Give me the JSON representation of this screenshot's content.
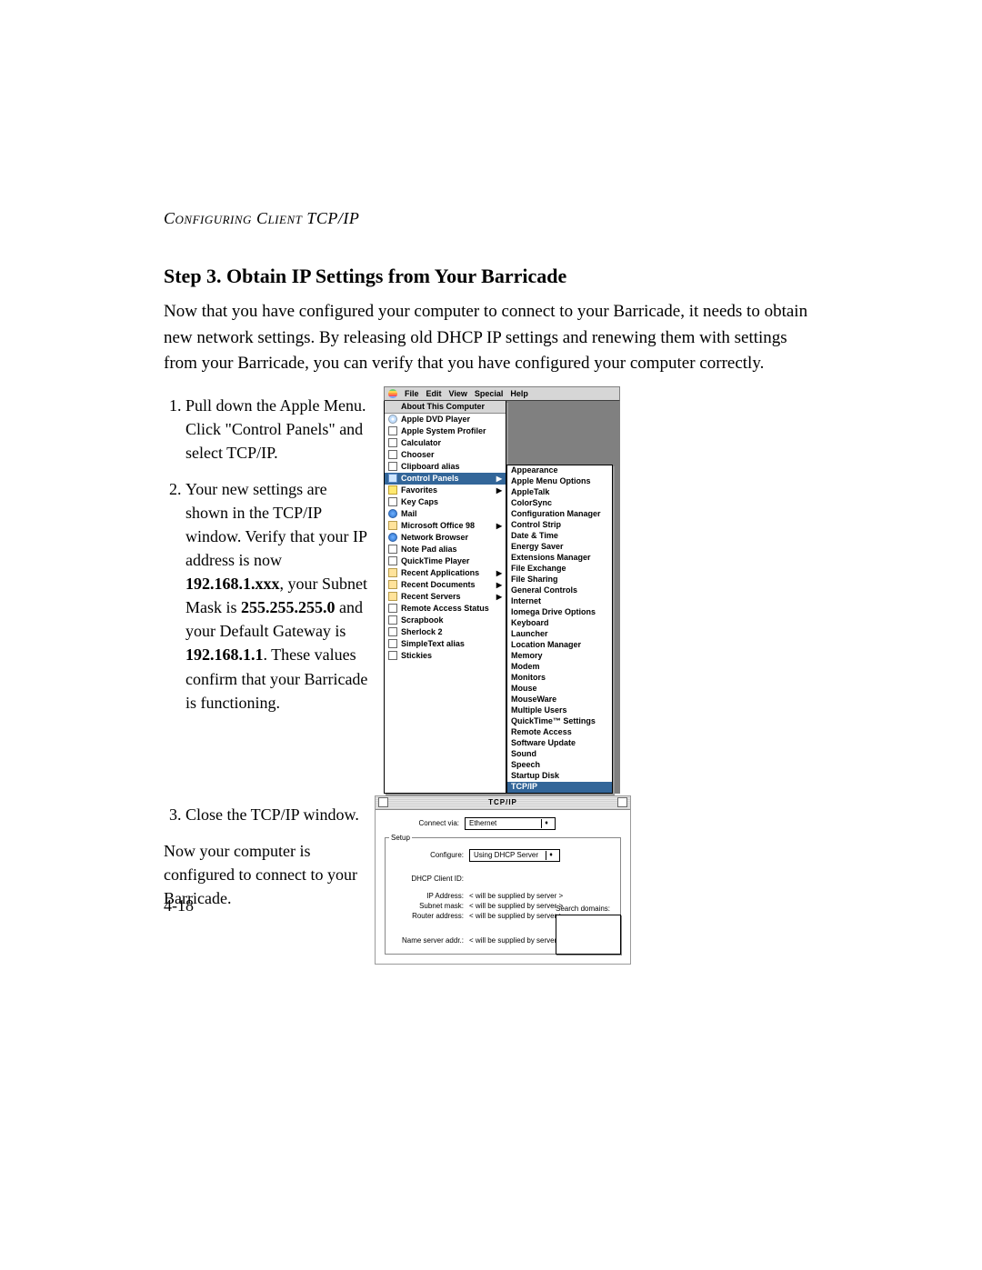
{
  "running_header": "Configuring Client TCP/IP",
  "step_title": "Step 3. Obtain IP Settings from Your Barricade",
  "intro": "Now that you have configured your computer to connect to your Barricade, it needs to obtain new network settings. By releasing old DHCP IP settings and renewing them with settings from your Barricade, you can verify that you have configured your computer correctly.",
  "list1": {
    "item1": "Pull down the Apple Menu. Click \"Control Panels\" and select TCP/IP.",
    "item2_pre": "Your new settings are shown in the TCP/IP window. Verify that your IP address is now ",
    "item2_ip": "192.168.1.xxx",
    "item2_mid1": ", your Subnet Mask is ",
    "item2_mask": "255.255.255.0",
    "item2_mid2": " and your Default Gateway is ",
    "item2_gw": "192.168.1.1",
    "item2_post": ". These values confirm that your Barricade is functioning."
  },
  "list2": {
    "item3": "Close the TCP/IP window."
  },
  "after": "Now your computer is configured to connect to your Barricade.",
  "page_number": "4-18",
  "menubar": {
    "file": "File",
    "edit": "Edit",
    "view": "View",
    "special": "Special",
    "help": "Help"
  },
  "apple_menu": {
    "title": "About This Computer",
    "items": [
      "Apple DVD Player",
      "Apple System Profiler",
      "Calculator",
      "Chooser",
      "Clipboard alias",
      "Control Panels",
      "Favorites",
      "Key Caps",
      "Mail",
      "Microsoft Office 98",
      "Network Browser",
      "Note Pad alias",
      "QuickTime Player",
      "Recent Applications",
      "Recent Documents",
      "Recent Servers",
      "Remote Access Status",
      "Scrapbook",
      "Sherlock 2",
      "SimpleText alias",
      "Stickies"
    ],
    "submenu_indices": [
      5,
      6,
      9,
      13,
      14,
      15
    ]
  },
  "control_panels": [
    "Appearance",
    "Apple Menu Options",
    "AppleTalk",
    "ColorSync",
    "Configuration Manager",
    "Control Strip",
    "Date & Time",
    "Energy Saver",
    "Extensions Manager",
    "File Exchange",
    "File Sharing",
    "General Controls",
    "Internet",
    "Iomega Drive Options",
    "Keyboard",
    "Launcher",
    "Location Manager",
    "Memory",
    "Modem",
    "Monitors",
    "Mouse",
    "MouseWare",
    "Multiple Users",
    "QuickTime™ Settings",
    "Remote Access",
    "Software Update",
    "Sound",
    "Speech",
    "Startup Disk",
    "TCP/IP"
  ],
  "tcpip_window": {
    "title": "TCP/IP",
    "connect_via_label": "Connect via:",
    "connect_via_value": "Ethernet",
    "setup_legend": "Setup",
    "configure_label": "Configure:",
    "configure_value": "Using DHCP Server",
    "dhcp_client_label": "DHCP Client ID:",
    "ip_label": "IP Address:",
    "subnet_label": "Subnet mask:",
    "router_label": "Router address:",
    "ns_label": "Name server addr.:",
    "supplied": "< will be supplied by server >",
    "search_domains_label": "Search domains:"
  }
}
